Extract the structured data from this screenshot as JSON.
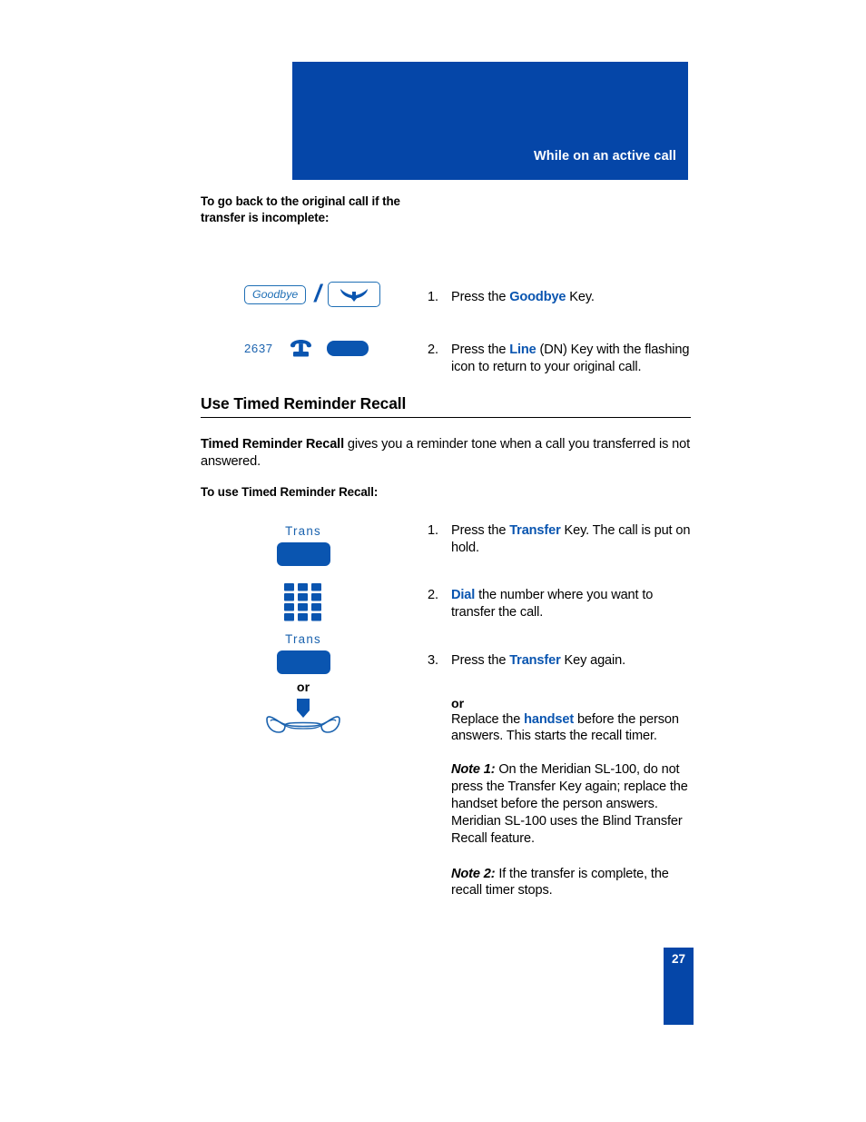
{
  "header": {
    "title": "While on an active call",
    "background_color": "#0546a8",
    "text_color": "#ffffff"
  },
  "colors": {
    "brand_blue": "#0546a8",
    "key_blue": "#0a55b0",
    "icon_outline_blue": "#1f6fb5",
    "text_black": "#000000"
  },
  "section_one": {
    "heading_line1": "To go back to the original call if the",
    "heading_line2": "transfer is incomplete:",
    "icons": {
      "goodbye_softkey_label": "Goodbye",
      "separator": "/",
      "release_icon_name": "handset-down-icon",
      "dn_number": "2637",
      "phone_icon_glyph": "☎",
      "line_key_name": "line-dn-key"
    },
    "steps": [
      {
        "number": "1.",
        "parts": [
          {
            "text": "Press the ",
            "style": "plain"
          },
          {
            "text": "Goodbye",
            "style": "key"
          },
          {
            "text": " Key.",
            "style": "plain"
          }
        ]
      },
      {
        "number": "2.",
        "parts": [
          {
            "text": "Press the ",
            "style": "plain"
          },
          {
            "text": "Line",
            "style": "key"
          },
          {
            "text": " (DN) Key with the flashing icon to return to your original call.",
            "style": "plain"
          }
        ]
      }
    ]
  },
  "section_two": {
    "title": "Use Timed Reminder Recall",
    "intro": {
      "bold_lead": "Timed Reminder Recall",
      "rest": " gives you a reminder tone when a call you transferred is not answered."
    },
    "sub_heading": "To use Timed Reminder Recall:",
    "icons": {
      "trans_label_1": "Trans",
      "trans_key_1_name": "transfer-key",
      "keypad_icon_name": "dialpad-icon",
      "trans_label_2": "Trans",
      "trans_key_2_name": "transfer-key",
      "or_label": "or",
      "handset_cradle_icon_name": "replace-handset-icon"
    },
    "steps": [
      {
        "number": "1.",
        "parts": [
          {
            "text": "Press the ",
            "style": "plain"
          },
          {
            "text": "Transfer",
            "style": "key"
          },
          {
            "text": " Key. The call is put on hold.",
            "style": "plain"
          }
        ]
      },
      {
        "number": "2.",
        "parts": [
          {
            "text": "",
            "style": "plain"
          },
          {
            "text": "Dial",
            "style": "key"
          },
          {
            "text": " the number where you want to transfer the call.",
            "style": "plain"
          }
        ]
      },
      {
        "number": "3.",
        "parts": [
          {
            "text": "Press the ",
            "style": "plain"
          },
          {
            "text": "Transfer",
            "style": "key"
          },
          {
            "text": " Key again.",
            "style": "plain"
          }
        ]
      }
    ],
    "alternative": {
      "or_label": "or",
      "parts": [
        {
          "text": "Replace the ",
          "style": "plain"
        },
        {
          "text": "handset",
          "style": "key"
        },
        {
          "text": " before the person answers. This starts the recall timer.",
          "style": "plain"
        }
      ]
    },
    "notes": [
      {
        "lead": "Note 1:",
        "text": "  On the Meridian SL-100, do not press the Transfer Key again; replace the handset before the person answers. Meridian SL-100 uses the Blind Transfer Recall feature."
      },
      {
        "lead": "Note 2:",
        "text": "   If the transfer is complete, the recall timer stops."
      }
    ]
  },
  "footer": {
    "page_number": "27"
  }
}
